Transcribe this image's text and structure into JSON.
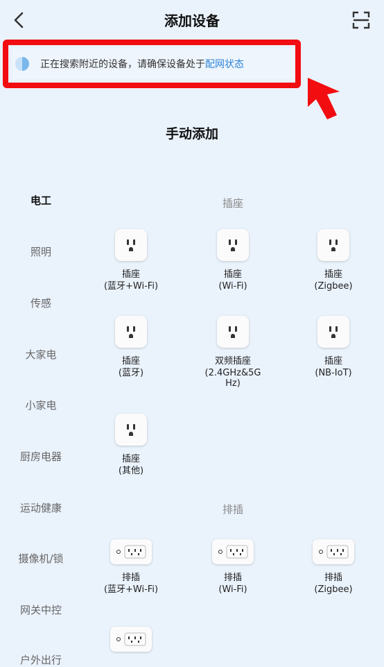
{
  "header": {
    "title": "添加设备"
  },
  "banner": {
    "text": "正在搜索附近的设备，请确保设备处于",
    "link": "配网状态"
  },
  "manual": {
    "title": "手动添加"
  },
  "sidebar": {
    "items": [
      {
        "label": "电工",
        "active": true
      },
      {
        "label": "照明",
        "active": false
      },
      {
        "label": "传感",
        "active": false
      },
      {
        "label": "大家电",
        "active": false
      },
      {
        "label": "小家电",
        "active": false
      },
      {
        "label": "厨房电器",
        "active": false
      },
      {
        "label": "运动健康",
        "active": false
      },
      {
        "label": "摄像机/锁",
        "active": false
      },
      {
        "label": "网关中控",
        "active": false
      },
      {
        "label": "户外出行",
        "active": false
      }
    ]
  },
  "categories": {
    "socket": {
      "header": "插座",
      "devices": [
        {
          "name": "插座",
          "sub": "(蓝牙+Wi-Fi)"
        },
        {
          "name": "插座",
          "sub": "(Wi-Fi)"
        },
        {
          "name": "插座",
          "sub": "(Zigbee)"
        },
        {
          "name": "插座",
          "sub": "(蓝牙)"
        },
        {
          "name": "双频插座",
          "sub": "(2.4GHz&5G",
          "sub2": "Hz)"
        },
        {
          "name": "插座",
          "sub": "(NB-IoT)"
        },
        {
          "name": "插座",
          "sub": "(其他)"
        }
      ]
    },
    "strip": {
      "header": "排插",
      "devices": [
        {
          "name": "排插",
          "sub": "(蓝牙+Wi-Fi)"
        },
        {
          "name": "排插",
          "sub": "(Wi-Fi)"
        },
        {
          "name": "排插",
          "sub": "(Zigbee)"
        },
        {
          "name": "",
          "sub": ""
        }
      ]
    }
  },
  "icons": {
    "back": "chevron-left-icon",
    "scan": "scan-icon",
    "spinner": "loading-spinner-icon",
    "arrow": "red-pointer-arrow-icon",
    "socket": "socket-icon",
    "strip": "power-strip-icon"
  },
  "colors": {
    "background": "#eaf2fc",
    "highlight": "#f20d10",
    "link": "#2f84d8"
  }
}
